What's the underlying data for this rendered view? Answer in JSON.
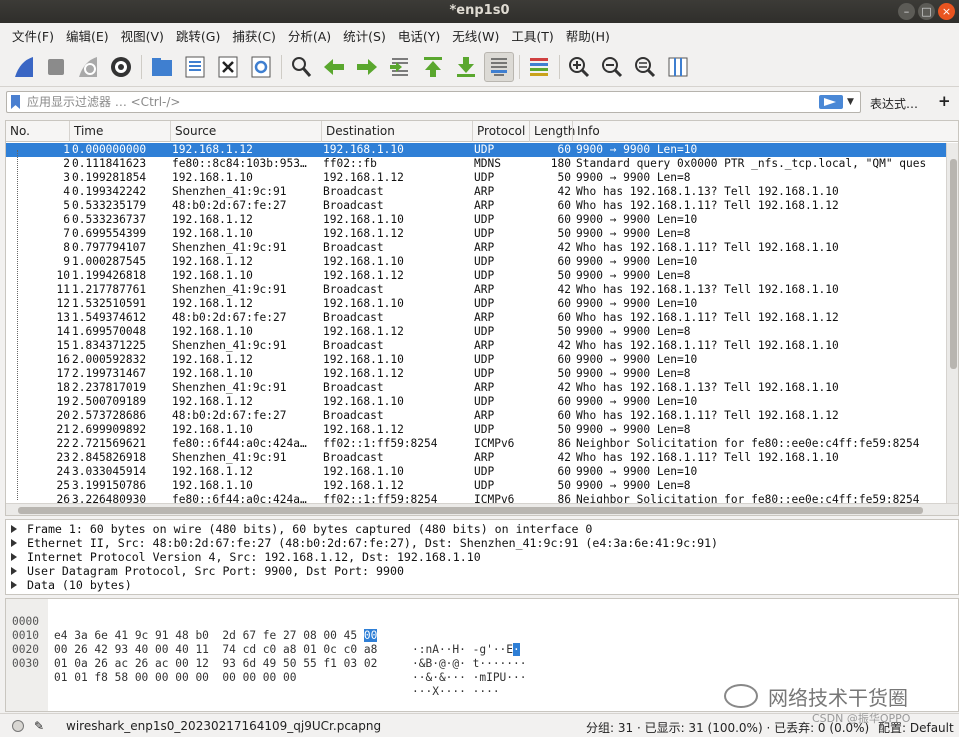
{
  "window": {
    "title": "*enp1s0"
  },
  "menu": [
    "文件(F)",
    "编辑(E)",
    "视图(V)",
    "跳转(G)",
    "捕获(C)",
    "分析(A)",
    "统计(S)",
    "电话(Y)",
    "无线(W)",
    "工具(T)",
    "帮助(H)"
  ],
  "toolbar": {
    "icons": [
      "start-capture-icon",
      "stop-capture-icon",
      "restart-capture-icon",
      "capture-options-icon",
      "open-file-icon",
      "save-file-icon",
      "close-file-icon",
      "reload-file-icon",
      "find-packet-icon",
      "go-back-icon",
      "go-forward-icon",
      "go-to-packet-icon",
      "go-first-icon",
      "go-last-icon",
      "autoscroll-icon",
      "colorize-icon",
      "zoom-in-icon",
      "zoom-out-icon",
      "zoom-normal-icon",
      "resize-columns-icon"
    ]
  },
  "filter": {
    "placeholder": "应用显示过滤器 … <Ctrl-/>",
    "value": "",
    "expression_label": "表达式…",
    "add_label": "+"
  },
  "packet_list": {
    "columns": [
      "No.",
      "Time",
      "Source",
      "Destination",
      "Protocol",
      "Length",
      "Info"
    ],
    "selected_index": 0,
    "rows": [
      [
        "1",
        "0.000000000",
        "192.168.1.12",
        "192.168.1.10",
        "UDP",
        "60",
        "9900 → 9900 Len=10"
      ],
      [
        "2",
        "0.111841623",
        "fe80::8c84:103b:953…",
        "ff02::fb",
        "MDNS",
        "180",
        "Standard query 0x0000 PTR _nfs._tcp.local, \"QM\" ques"
      ],
      [
        "3",
        "0.199281854",
        "192.168.1.10",
        "192.168.1.12",
        "UDP",
        "50",
        "9900 → 9900 Len=8"
      ],
      [
        "4",
        "0.199342242",
        "Shenzhen_41:9c:91",
        "Broadcast",
        "ARP",
        "42",
        "Who has 192.168.1.13? Tell 192.168.1.10"
      ],
      [
        "5",
        "0.533235179",
        "48:b0:2d:67:fe:27",
        "Broadcast",
        "ARP",
        "60",
        "Who has 192.168.1.11? Tell 192.168.1.12"
      ],
      [
        "6",
        "0.533236737",
        "192.168.1.12",
        "192.168.1.10",
        "UDP",
        "60",
        "9900 → 9900 Len=10"
      ],
      [
        "7",
        "0.699554399",
        "192.168.1.10",
        "192.168.1.12",
        "UDP",
        "50",
        "9900 → 9900 Len=8"
      ],
      [
        "8",
        "0.797794107",
        "Shenzhen_41:9c:91",
        "Broadcast",
        "ARP",
        "42",
        "Who has 192.168.1.11? Tell 192.168.1.10"
      ],
      [
        "9",
        "1.000287545",
        "192.168.1.12",
        "192.168.1.10",
        "UDP",
        "60",
        "9900 → 9900 Len=10"
      ],
      [
        "10",
        "1.199426818",
        "192.168.1.10",
        "192.168.1.12",
        "UDP",
        "50",
        "9900 → 9900 Len=8"
      ],
      [
        "11",
        "1.217787761",
        "Shenzhen_41:9c:91",
        "Broadcast",
        "ARP",
        "42",
        "Who has 192.168.1.13? Tell 192.168.1.10"
      ],
      [
        "12",
        "1.532510591",
        "192.168.1.12",
        "192.168.1.10",
        "UDP",
        "60",
        "9900 → 9900 Len=10"
      ],
      [
        "13",
        "1.549374612",
        "48:b0:2d:67:fe:27",
        "Broadcast",
        "ARP",
        "60",
        "Who has 192.168.1.11? Tell 192.168.1.12"
      ],
      [
        "14",
        "1.699570048",
        "192.168.1.10",
        "192.168.1.12",
        "UDP",
        "50",
        "9900 → 9900 Len=8"
      ],
      [
        "15",
        "1.834371225",
        "Shenzhen_41:9c:91",
        "Broadcast",
        "ARP",
        "42",
        "Who has 192.168.1.11? Tell 192.168.1.10"
      ],
      [
        "16",
        "2.000592832",
        "192.168.1.12",
        "192.168.1.10",
        "UDP",
        "60",
        "9900 → 9900 Len=10"
      ],
      [
        "17",
        "2.199731467",
        "192.168.1.10",
        "192.168.1.12",
        "UDP",
        "50",
        "9900 → 9900 Len=8"
      ],
      [
        "18",
        "2.237817019",
        "Shenzhen_41:9c:91",
        "Broadcast",
        "ARP",
        "42",
        "Who has 192.168.1.13? Tell 192.168.1.10"
      ],
      [
        "19",
        "2.500709189",
        "192.168.1.12",
        "192.168.1.10",
        "UDP",
        "60",
        "9900 → 9900 Len=10"
      ],
      [
        "20",
        "2.573728686",
        "48:b0:2d:67:fe:27",
        "Broadcast",
        "ARP",
        "60",
        "Who has 192.168.1.11? Tell 192.168.1.12"
      ],
      [
        "21",
        "2.699909892",
        "192.168.1.10",
        "192.168.1.12",
        "UDP",
        "50",
        "9900 → 9900 Len=8"
      ],
      [
        "22",
        "2.721569621",
        "fe80::6f44:a0c:424a…",
        "ff02::1:ff59:8254",
        "ICMPv6",
        "86",
        "Neighbor Solicitation for fe80::ee0e:c4ff:fe59:8254"
      ],
      [
        "23",
        "2.845826918",
        "Shenzhen_41:9c:91",
        "Broadcast",
        "ARP",
        "42",
        "Who has 192.168.1.11? Tell 192.168.1.10"
      ],
      [
        "24",
        "3.033045914",
        "192.168.1.12",
        "192.168.1.10",
        "UDP",
        "60",
        "9900 → 9900 Len=10"
      ],
      [
        "25",
        "3.199150786",
        "192.168.1.10",
        "192.168.1.12",
        "UDP",
        "50",
        "9900 → 9900 Len=8"
      ],
      [
        "26",
        "3.226480930",
        "fe80::6f44:a0c:424a…",
        "ff02::1:ff59:8254",
        "ICMPv6",
        "86",
        "Neighbor Solicitation for fe80::ee0e:c4ff:fe59:8254"
      ]
    ]
  },
  "details": [
    "Frame 1: 60 bytes on wire (480 bits), 60 bytes captured (480 bits) on interface 0",
    "Ethernet II, Src: 48:b0:2d:67:fe:27 (48:b0:2d:67:fe:27), Dst: Shenzhen_41:9c:91 (e4:3a:6e:41:9c:91)",
    "Internet Protocol Version 4, Src: 192.168.1.12, Dst: 192.168.1.10",
    "User Datagram Protocol, Src Port: 9900, Dst Port: 9900",
    "Data (10 bytes)"
  ],
  "bytes": [
    {
      "offset": "0000",
      "hex": "e4 3a 6e 41 9c 91 48 b0  2d 67 fe 27 08 00 45 ",
      "hex_hl": "00",
      "ascii": "·:nA··H· -g'··E",
      "ascii_hl": "·"
    },
    {
      "offset": "0010",
      "hex": "00 26 42 93 40 00 40 11  74 cd c0 a8 01 0c c0 a8",
      "hex_hl": "",
      "ascii": "·&B·@·@· t·······",
      "ascii_hl": ""
    },
    {
      "offset": "0020",
      "hex": "01 0a 26 ac 26 ac 00 12  93 6d 49 50 55 f1 03 02",
      "hex_hl": "",
      "ascii": "··&·&··· ·mIPU···",
      "ascii_hl": ""
    },
    {
      "offset": "0030",
      "hex": "01 01 f8 58 00 00 00 00  00 00 00 00",
      "hex_hl": "",
      "ascii": "···X···· ····",
      "ascii_hl": ""
    }
  ],
  "watermark": {
    "text": "网络技术干货圈",
    "csdn": "CSDN @振华OPPO"
  },
  "status": {
    "file": "wireshark_enp1s0_20230217164109_qj9UCr.pcapng",
    "stats": "分组: 31 · 已显示: 31 (100.0%) · 已丢弃: 0 (0.0%)",
    "profile": "配置: Default"
  },
  "colors": {
    "selection": "#2f7fd6",
    "titlebar": "#3c3b37",
    "close_button": "#e95420"
  }
}
